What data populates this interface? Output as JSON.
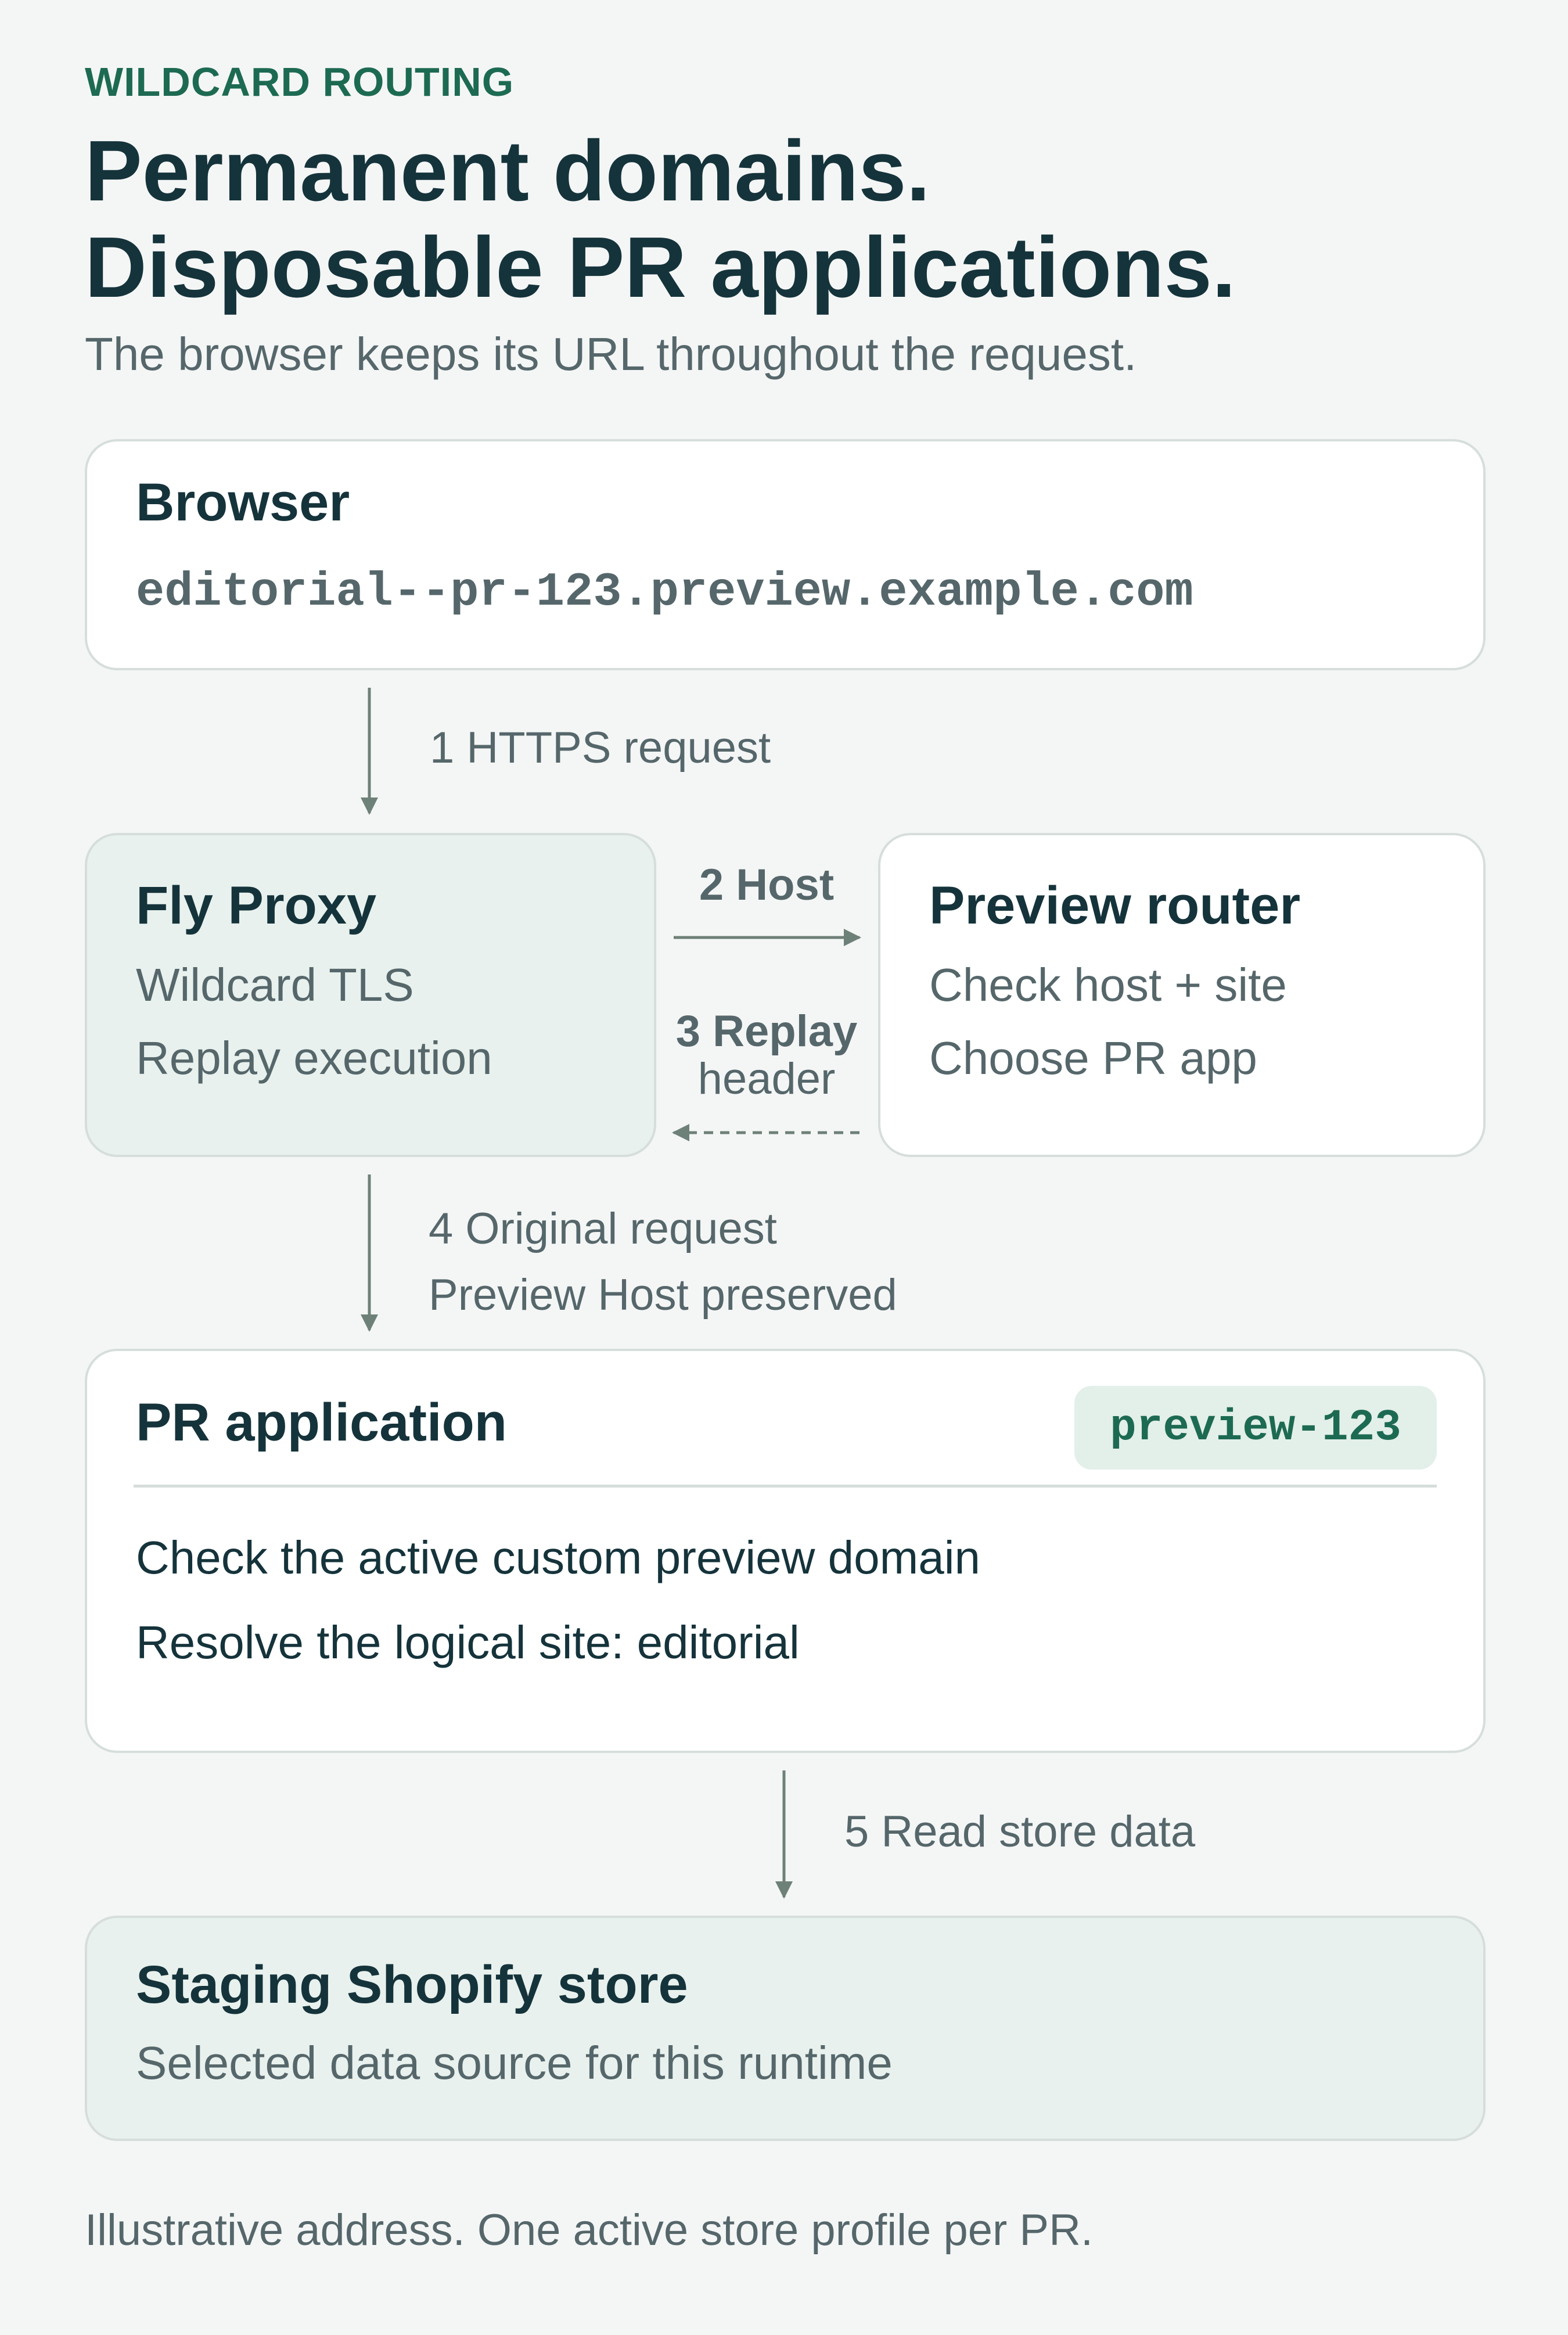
{
  "eyebrow": "WILDCARD ROUTING",
  "headline": {
    "line1": "Permanent domains.",
    "line2": "Disposable PR applications."
  },
  "subtitle": "The browser keeps its URL throughout the request.",
  "browser": {
    "title": "Browser",
    "url": "editorial--pr-123.preview.example.com"
  },
  "steps": {
    "step1": "1 HTTPS request",
    "step2": "2 Host",
    "step3_bold": "3 Replay",
    "step3_rest": "header",
    "step4_line1": "4 Original request",
    "step4_line2": "Preview Host preserved",
    "step5": "5 Read store data"
  },
  "fly_proxy": {
    "title": "Fly Proxy",
    "lines": [
      "Wildcard TLS",
      "Replay execution"
    ]
  },
  "preview_router": {
    "title": "Preview router",
    "lines": [
      "Check host + site",
      "Choose PR app"
    ]
  },
  "pr_app": {
    "title": "PR application",
    "badge": "preview-123",
    "lines": [
      "Check the active custom preview domain",
      "Resolve the logical site: editorial"
    ]
  },
  "store": {
    "title": "Staging Shopify store",
    "subtitle": "Selected data source for this runtime"
  },
  "footnote": "Illustrative address. One active store profile per PR.",
  "colors": {
    "background": "#f4f6f5",
    "accent": "#1d6a52",
    "text": "#15333b",
    "muted": "#56676b",
    "tint": "#e8f1ed",
    "arrow": "#6e8178"
  }
}
